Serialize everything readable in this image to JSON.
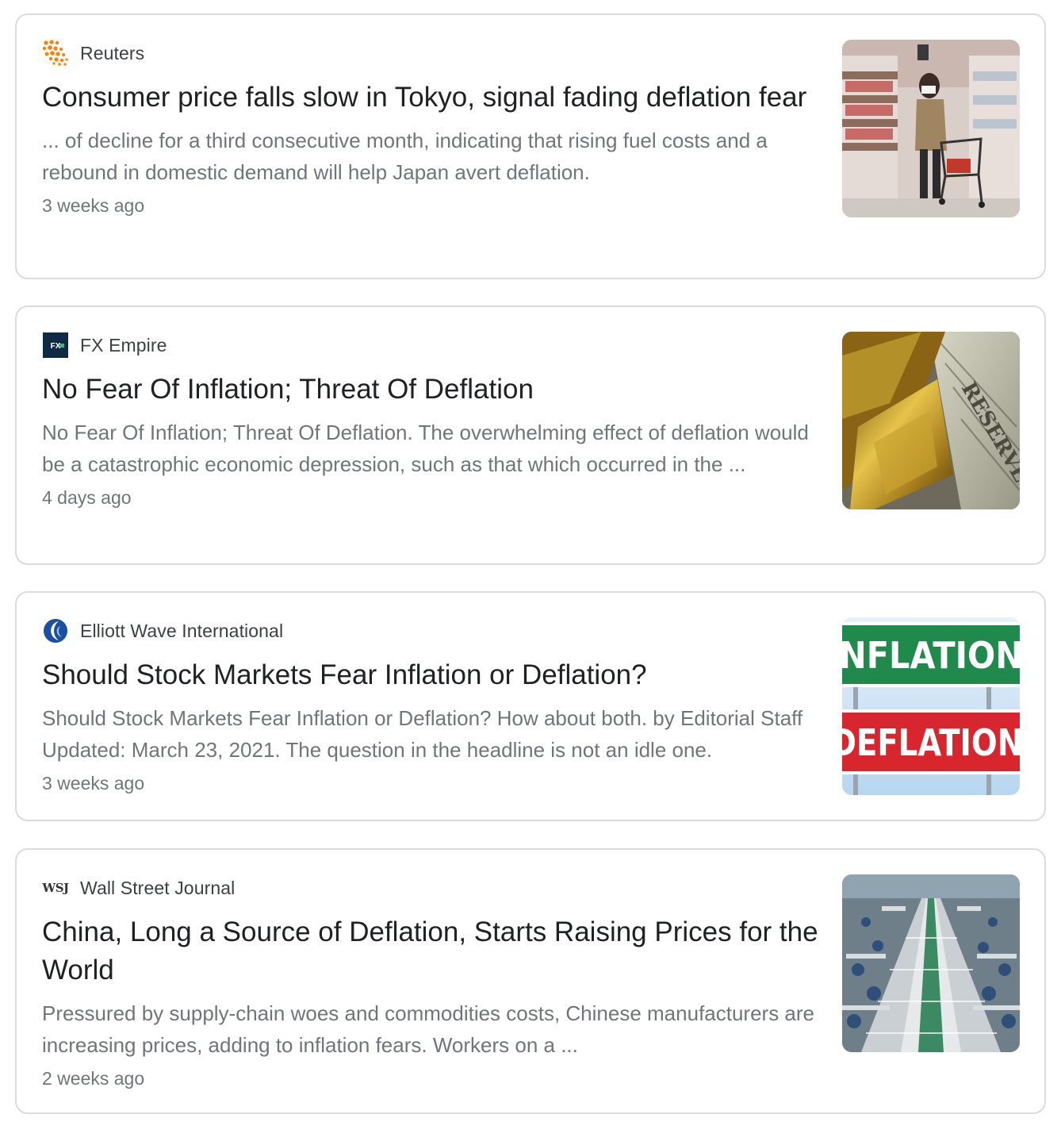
{
  "articles": [
    {
      "source": "Reuters",
      "source_icon": "reuters-icon",
      "headline": "Consumer price falls slow in Tokyo, signal fading deflation fear",
      "snippet": "... of decline for a third consecutive month, indicating that rising fuel costs and a rebound in domestic demand will help Japan avert deflation.",
      "time": "3 weeks ago",
      "thumbnail": "supermarket-shopper-image"
    },
    {
      "source": "FX Empire",
      "source_icon": "fx-empire-icon",
      "headline": "No Fear Of Inflation; Threat Of Deflation",
      "snippet": "No Fear Of Inflation; Threat Of Deflation. The overwhelming effect of deflation would be a catastrophic economic depression, such as that which occurred in the ...",
      "time": "4 days ago",
      "thumbnail": "gold-bar-and-dollar-image"
    },
    {
      "source": "Elliott Wave International",
      "source_icon": "elliott-wave-icon",
      "headline": "Should Stock Markets Fear Inflation or Deflation?",
      "snippet": "Should Stock Markets Fear Inflation or Deflation? How about both. by Editorial Staff Updated: March 23, 2021. The question in the headline is not an idle one.",
      "time": "3 weeks ago",
      "thumbnail": "inflation-deflation-signs-image",
      "thumb_text_top": "NFLATION",
      "thumb_text_bottom": "DEFLATION"
    },
    {
      "source": "Wall Street Journal",
      "source_icon": "wsj-icon",
      "source_icon_text": "WSJ",
      "headline": "China, Long a Source of Deflation, Starts Raising Prices for the World",
      "snippet": "Pressured by supply-chain woes and commodities costs, Chinese manufacturers are increasing prices, adding to inflation fears. Workers on a ...",
      "time": "2 weeks ago",
      "thumbnail": "factory-assembly-line-image"
    }
  ],
  "colors": {
    "card_border": "#dadce0",
    "headline": "#202124",
    "snippet": "#70757a",
    "reuters_orange": "#ff8000",
    "fx_navy": "#0f2a44",
    "inflation_green": "#1f8a4c",
    "deflation_red": "#d7262e"
  }
}
